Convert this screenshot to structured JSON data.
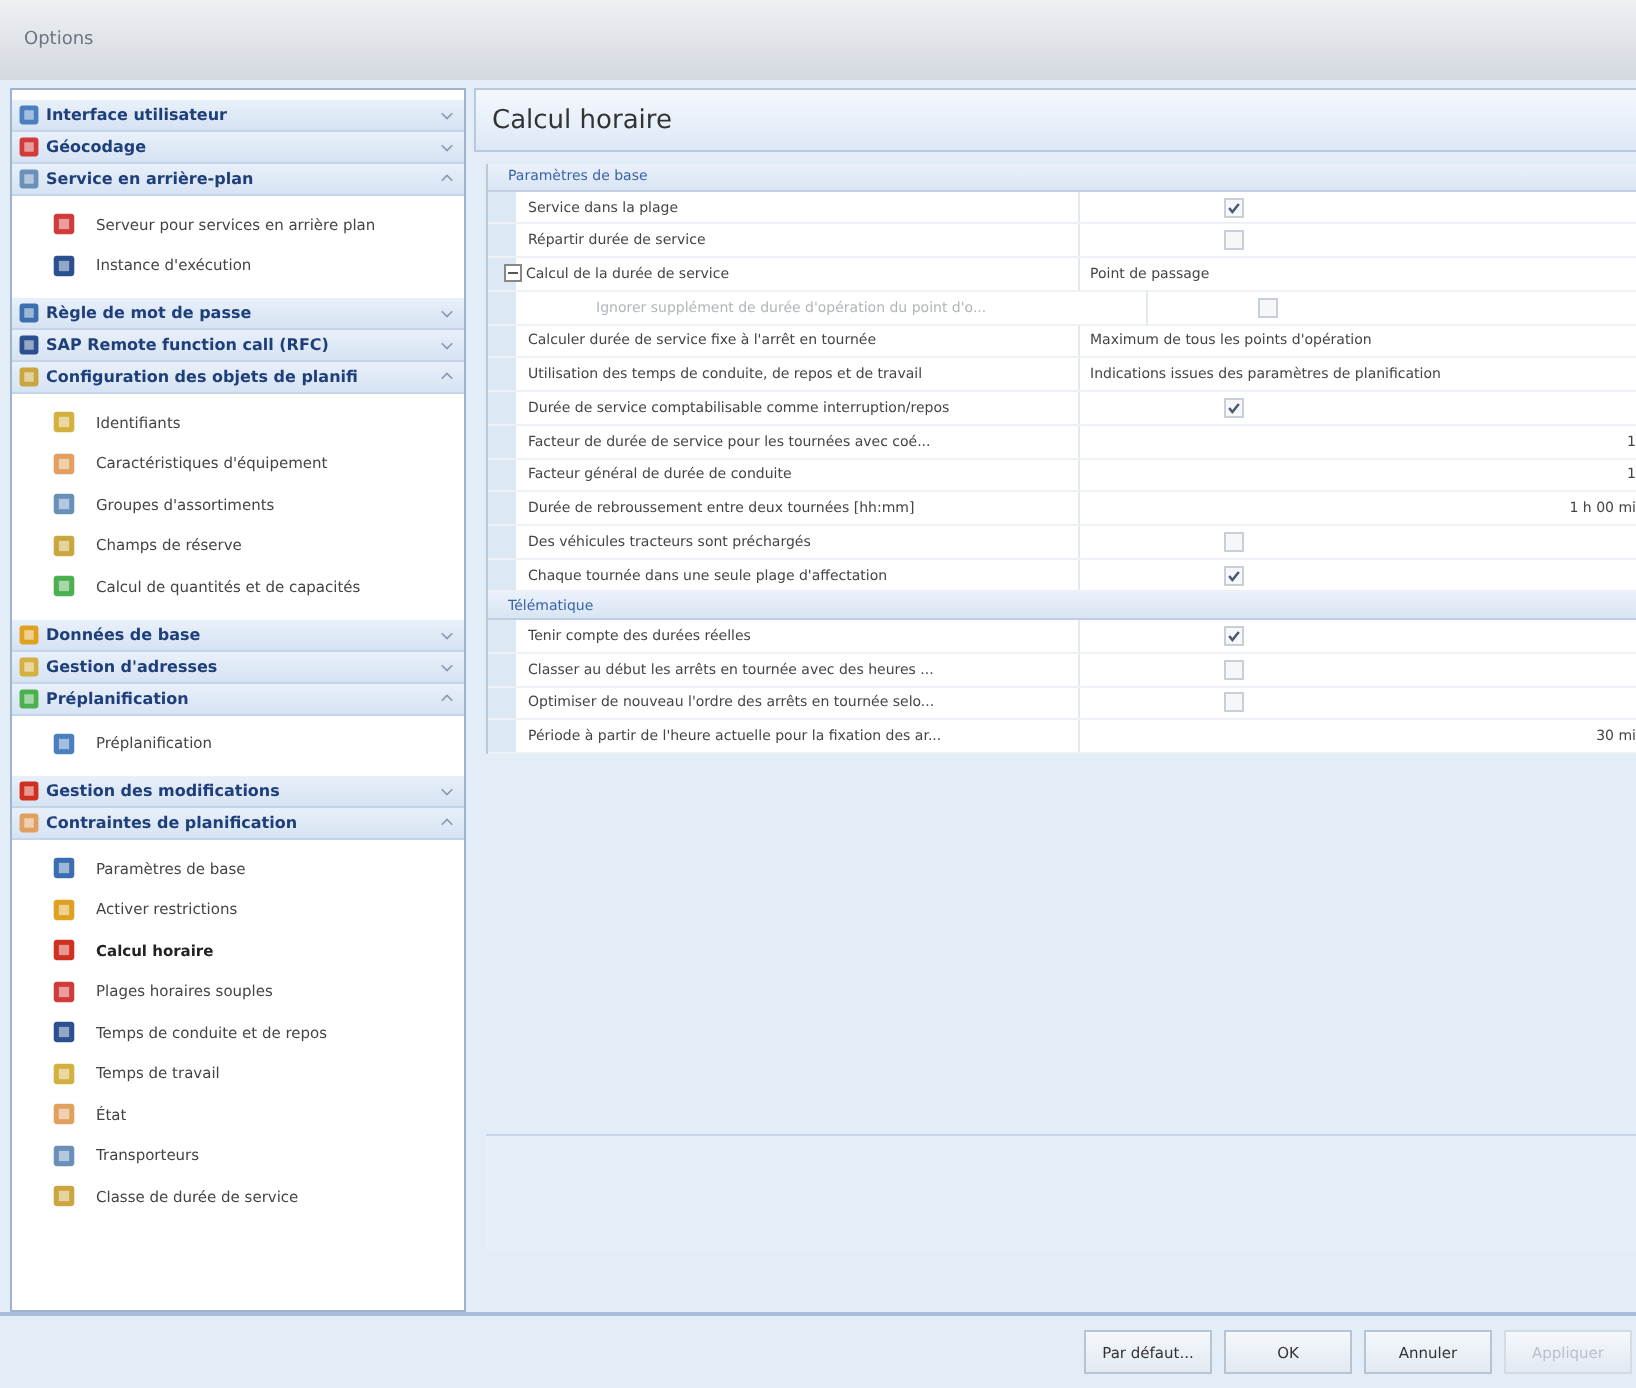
{
  "window": {
    "title": "Options"
  },
  "sidebar": {
    "groups": [
      {
        "label": "Interface utilisateur",
        "expanded": false
      },
      {
        "label": "Géocodage",
        "expanded": false
      },
      {
        "label": "Service en arrière-plan",
        "expanded": true,
        "children": [
          {
            "label": "Serveur pour services en arrière plan",
            "selected": false
          },
          {
            "label": "Instance d'exécution",
            "selected": false
          }
        ]
      },
      {
        "label": "Règle de mot de passe",
        "expanded": false
      },
      {
        "label": "SAP Remote function call (RFC)",
        "expanded": false
      },
      {
        "label": "Configuration des objets de planifi",
        "expanded": true,
        "children": [
          {
            "label": "Identifiants",
            "selected": false
          },
          {
            "label": "Caractéristiques d'équipement",
            "selected": false
          },
          {
            "label": "Groupes d'assortiments",
            "selected": false
          },
          {
            "label": "Champs de réserve",
            "selected": false
          },
          {
            "label": "Calcul de quantités et de capacités",
            "selected": false
          }
        ]
      },
      {
        "label": "Données de base",
        "expanded": false
      },
      {
        "label": "Gestion d'adresses",
        "expanded": false
      },
      {
        "label": "Préplanification",
        "expanded": true,
        "children": [
          {
            "label": "Préplanification",
            "selected": false
          }
        ]
      },
      {
        "label": "Gestion des modifications",
        "expanded": false
      },
      {
        "label": "Contraintes de planification",
        "expanded": true,
        "children": [
          {
            "label": "Paramètres de base",
            "selected": false
          },
          {
            "label": "Activer restrictions",
            "selected": false
          },
          {
            "label": "Calcul horaire",
            "selected": true
          },
          {
            "label": "Plages horaires souples",
            "selected": false
          },
          {
            "label": "Temps de conduite et de repos",
            "selected": false
          },
          {
            "label": "Temps de travail",
            "selected": false
          },
          {
            "label": "État",
            "selected": false
          },
          {
            "label": "Transporteurs",
            "selected": false
          },
          {
            "label": "Classe de durée de service",
            "selected": false
          }
        ]
      }
    ]
  },
  "page": {
    "title": "Calcul horaire"
  },
  "grid": {
    "sections": [
      {
        "title": "Paramètres de base",
        "rows": [
          {
            "label": "Service dans la plage",
            "kind": "check",
            "checked": true
          },
          {
            "label": "Répartir durée de service",
            "kind": "check",
            "checked": false
          },
          {
            "label": "Calcul de la durée de service",
            "kind": "text",
            "value": "Point de passage",
            "expanded": true,
            "children": [
              {
                "label": "Ignorer supplément de durée d'opération du point d'o...",
                "kind": "check",
                "checked": false,
                "disabled": true
              }
            ]
          },
          {
            "label": "Calculer durée de service fixe à l'arrêt en tournée",
            "kind": "text",
            "value": "Maximum de tous les points d'opération"
          },
          {
            "label": "Utilisation des temps de conduite, de repos et de travail",
            "kind": "text",
            "value": "Indications issues des paramètres de planification"
          },
          {
            "label": "Durée de service comptabilisable comme interruption/repos",
            "kind": "check",
            "checked": true
          },
          {
            "label": "Facteur de durée de service pour les tournées avec coé...",
            "kind": "number",
            "value": "1"
          },
          {
            "label": "Facteur général de durée de conduite",
            "kind": "number",
            "value": "1"
          },
          {
            "label": "Durée de rebroussement entre deux tournées [hh:mm]",
            "kind": "number",
            "value": "1 h 00 mi"
          },
          {
            "label": "Des véhicules tracteurs sont préchargés",
            "kind": "check",
            "checked": false
          },
          {
            "label": "Chaque tournée dans une seule plage d'affectation",
            "kind": "check",
            "checked": true
          }
        ]
      },
      {
        "title": "Télématique",
        "rows": [
          {
            "label": "Tenir compte des durées réelles",
            "kind": "check",
            "checked": true
          },
          {
            "label": "Classer au début les arrêts en tournée avec des heures ...",
            "kind": "check",
            "checked": false
          },
          {
            "label": "Optimiser de nouveau l'ordre des arrêts en tournée selo...",
            "kind": "check",
            "checked": false
          },
          {
            "label": "Période à partir de l'heure actuelle pour la fixation des ar...",
            "kind": "number",
            "value": "30 mi"
          }
        ]
      }
    ]
  },
  "buttons": [
    {
      "label": "Par défaut...",
      "disabled": false
    },
    {
      "label": "OK",
      "disabled": false
    },
    {
      "label": "Annuler",
      "disabled": false
    },
    {
      "label": "Appliquer",
      "disabled": true
    }
  ]
}
